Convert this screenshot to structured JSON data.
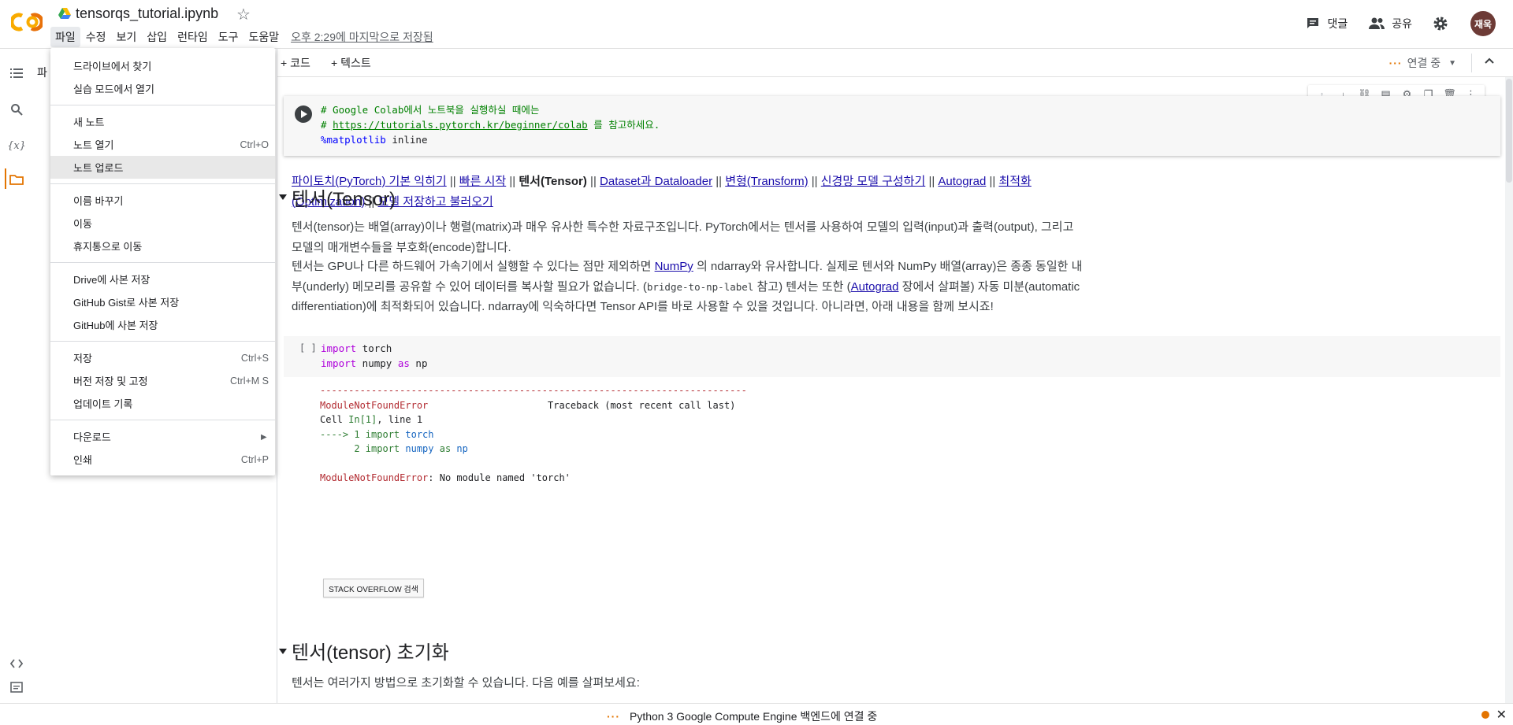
{
  "header": {
    "notebook_title": "tensorqs_tutorial.ipynb",
    "menus": [
      "파일",
      "수정",
      "보기",
      "삽입",
      "런타임",
      "도구",
      "도움말"
    ],
    "saved_status": "오후 2:29에 마지막으로 저장됨",
    "comment_label": "댓글",
    "share_label": "공유",
    "avatar_text": "재욱"
  },
  "toolbar": {
    "add_code": "+ 코드",
    "add_text": "+ 텍스트",
    "connection": "연결 중"
  },
  "panel": {
    "title_fragment": "파"
  },
  "file_menu": {
    "groups": [
      [
        {
          "label": "드라이브에서 찾기",
          "shortcut": ""
        },
        {
          "label": "실습 모드에서 열기",
          "shortcut": ""
        }
      ],
      [
        {
          "label": "새 노트",
          "shortcut": ""
        },
        {
          "label": "노트 열기",
          "shortcut": "Ctrl+O"
        },
        {
          "label": "노트 업로드",
          "shortcut": ""
        }
      ],
      [
        {
          "label": "이름 바꾸기",
          "shortcut": ""
        },
        {
          "label": "이동",
          "shortcut": ""
        },
        {
          "label": "휴지통으로 이동",
          "shortcut": ""
        }
      ],
      [
        {
          "label": "Drive에 사본 저장",
          "shortcut": ""
        },
        {
          "label": "GitHub Gist로 사본 저장",
          "shortcut": ""
        },
        {
          "label": "GitHub에 사본 저장",
          "shortcut": ""
        }
      ],
      [
        {
          "label": "저장",
          "shortcut": "Ctrl+S"
        },
        {
          "label": "버전 저장 및 고정",
          "shortcut": "Ctrl+M S"
        },
        {
          "label": "업데이트 기록",
          "shortcut": ""
        }
      ],
      [
        {
          "label": "다운로드",
          "shortcut": "►"
        },
        {
          "label": "인쇄",
          "shortcut": "Ctrl+P"
        }
      ]
    ],
    "highlighted": "노트 업로드"
  },
  "cell1": {
    "line1": "# Google Colab에서 노트북을 실행하실 때에는",
    "line2_prefix": "# ",
    "line2_link": "https://tutorials.pytorch.kr/beginner/colab",
    "line2_suffix": " 를 참고하세요.",
    "line3_magic": "%matplotlib",
    "line3_rest": " inline"
  },
  "nav": {
    "links": [
      "파이토치(PyTorch) 기본 익히기",
      "빠른 시작",
      "텐서(Tensor)",
      "Dataset과 Dataloader",
      "변형(Transform)",
      "신경망 모델 구성하기",
      "Autograd",
      "최적화(Optimization)",
      "모델 저장하고 불러오기"
    ],
    "sep": " || "
  },
  "section1": {
    "title": "텐서(Tensor)",
    "p1": "텐서(tensor)는 배열(array)이나 행렬(matrix)과 매우 유사한 특수한 자료구조입니다. PyTorch에서는 텐서를 사용하여 모델의 입력(input)과 출력(output), 그리고 모델의 매개변수들을 부호화(encode)합니다.",
    "p2_a": "텐서는 GPU나 다른 하드웨어 가속기에서 실행할 수 있다는 점만 제외하면 ",
    "p2_link1": "NumPy",
    "p2_b": " 의 ndarray와 유사합니다. 실제로 텐서와 NumPy 배열(array)은 종종 동일한 내부(underly) 메모리를 공유할 수 있어 데이터를 복사할 필요가 없습니다. (",
    "p2_mono": "bridge-to-np-label",
    "p2_c": " 참고) 텐서는 또한 (",
    "p2_link2": "Autograd",
    "p2_d": " 장에서 살펴볼) 자동 미분(automatic differentiation)에 최적화되어 있습니다. ndarray에 익숙하다면 Tensor API를 바로 사용할 수 있을 것입니다. 아니라면, 아래 내용을 함께 보시죠!"
  },
  "cell2": {
    "bracket": "[ ]",
    "l1_kw": "import",
    "l1_rest": " torch",
    "l2_kw": "import",
    "l2_mid": " numpy ",
    "l2_kw2": "as",
    "l2_rest": " np"
  },
  "output": {
    "dashes": "---------------------------------------------------------------------------",
    "err_name": "ModuleNotFoundError",
    "traceback": "                     Traceback (most recent call last)",
    "cell_prefix": "Cell ",
    "cell_in": "In[1]",
    "cell_line": ", line 1",
    "arrow": "----> 1 ",
    "a_import": "import",
    "a_torch": " torch",
    "l2_num": "      2 ",
    "l2_import": "import",
    "l2_numpy": " numpy",
    "l2_as": " as",
    "l2_np": " np",
    "msg": ": No module named 'torch'",
    "so_button": "STACK OVERFLOW 검색"
  },
  "section2": {
    "title": "텐서(tensor) 초기화",
    "p1": "텐서는 여러가지 방법으로 초기화할 수 있습니다. 다음 예를 살펴보세요:"
  },
  "status": {
    "text": "Python 3 Google Compute Engine 백엔드에 연결 중"
  },
  "colors": {
    "accent": "#e37400",
    "link": "#1a0dab",
    "error": "#b22b31"
  }
}
